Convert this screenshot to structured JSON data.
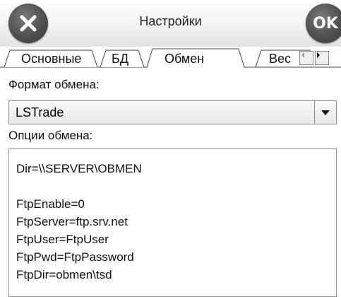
{
  "window": {
    "title": "Настройки",
    "close_icon": "close-x-icon",
    "ok_label": "OK"
  },
  "tabs": [
    {
      "label": "Основные",
      "selected": false
    },
    {
      "label": "БД",
      "selected": false
    },
    {
      "label": "Обмен",
      "selected": true
    },
    {
      "label": "Вес",
      "selected": false
    }
  ],
  "tab_scroll": {
    "left_icon": "scroll-left-icon",
    "right_icon": "scroll-right-icon"
  },
  "exchange_format": {
    "label": "Формат обмена:",
    "value": "LSTrade"
  },
  "exchange_options": {
    "label": "Опции обмена:",
    "lines": [
      "Dir=\\\\SERVER\\OBMEN",
      "",
      "FtpEnable=0",
      "FtpServer=ftp.srv.net",
      "FtpUser=FtpUser",
      "FtpPwd=FtpPassword",
      "FtpDir=obmen\\tsd"
    ]
  }
}
